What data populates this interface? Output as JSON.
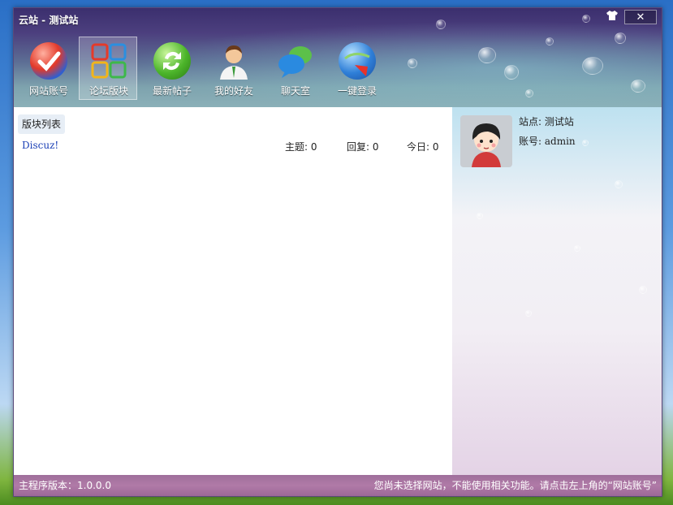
{
  "window": {
    "title": "云站 - 测试站"
  },
  "toolbar": {
    "items": [
      {
        "label": "网站账号",
        "icon": "check-badge-icon"
      },
      {
        "label": "论坛版块",
        "icon": "grid-blocks-icon"
      },
      {
        "label": "最新帖子",
        "icon": "refresh-arrows-icon"
      },
      {
        "label": "我的好友",
        "icon": "person-icon"
      },
      {
        "label": "聊天室",
        "icon": "chat-bubbles-icon"
      },
      {
        "label": "一键登录",
        "icon": "globe-login-icon"
      }
    ],
    "active_index": 1
  },
  "main": {
    "block_list_label": "版块列表",
    "forums": [
      {
        "name": "Discuz!",
        "topics": "主题: 0",
        "replies": "回复: 0",
        "today": "今日: 0"
      }
    ]
  },
  "side": {
    "site": "站点: 测试站",
    "account": "账号: admin"
  },
  "status": {
    "version": "主程序版本：1.0.0.0",
    "message": "您尚未选择网站，不能使用相关功能。请点击左上角的“网站账号”"
  },
  "colors": {
    "accent_purple": "#4c3f7e",
    "status_bar": "#b07aa7",
    "link_blue": "#1a3fb5"
  }
}
